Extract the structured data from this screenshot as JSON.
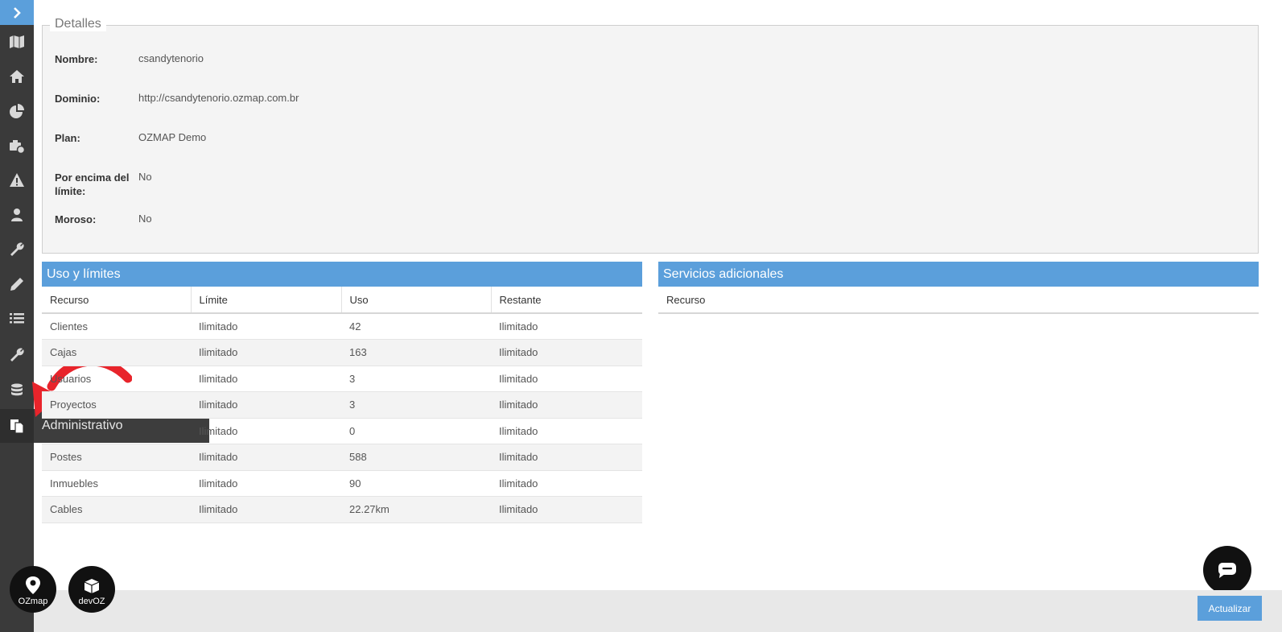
{
  "sidebar": {
    "icons": [
      "chevron-right-icon",
      "map-icon",
      "home-icon",
      "pie-chart-icon",
      "toolbox-clock-icon",
      "warning-icon",
      "user-icon",
      "wrench-icon",
      "pencil-icon",
      "list-icon",
      "wrench-icon",
      "database-icon",
      "documents-icon"
    ],
    "active_tooltip": "Administrativo"
  },
  "details": {
    "legend": "Detalles",
    "fields": [
      {
        "label": "Nombre:",
        "value": "csandytenorio"
      },
      {
        "label": "Dominio:",
        "value": "http://csandytenorio.ozmap.com.br"
      },
      {
        "label": "Plan:",
        "value": "OZMAP Demo"
      },
      {
        "label": "Por encima del límite:",
        "value": "No"
      },
      {
        "label": "Moroso:",
        "value": "No"
      }
    ]
  },
  "usage": {
    "title": "Uso y límites",
    "columns": [
      "Recurso",
      "Límite",
      "Uso",
      "Restante"
    ],
    "rows": [
      [
        "Clientes",
        "Ilimitado",
        "42",
        "Ilimitado"
      ],
      [
        "Cajas",
        "Ilimitado",
        "163",
        "Ilimitado"
      ],
      [
        "Usuarios",
        "Ilimitado",
        "3",
        "Ilimitado"
      ],
      [
        "Proyectos",
        "Ilimitado",
        "3",
        "Ilimitado"
      ],
      [
        "",
        "Ilimitado",
        "0",
        "Ilimitado"
      ],
      [
        "Postes",
        "Ilimitado",
        "588",
        "Ilimitado"
      ],
      [
        "Inmuebles",
        "Ilimitado",
        "90",
        "Ilimitado"
      ],
      [
        "Cables",
        "Ilimitado",
        "22.27km",
        "Ilimitado"
      ]
    ]
  },
  "services": {
    "title": "Servicios adicionales",
    "columns": [
      "Recurso"
    ]
  },
  "footer": {
    "update_label": "Actualizar",
    "logos": [
      "OZmap",
      "devOZ"
    ]
  },
  "colors": {
    "accent": "#5b9fdb",
    "sidebar": "#3a3a3a",
    "annotation_arrow": "#e8242b"
  }
}
